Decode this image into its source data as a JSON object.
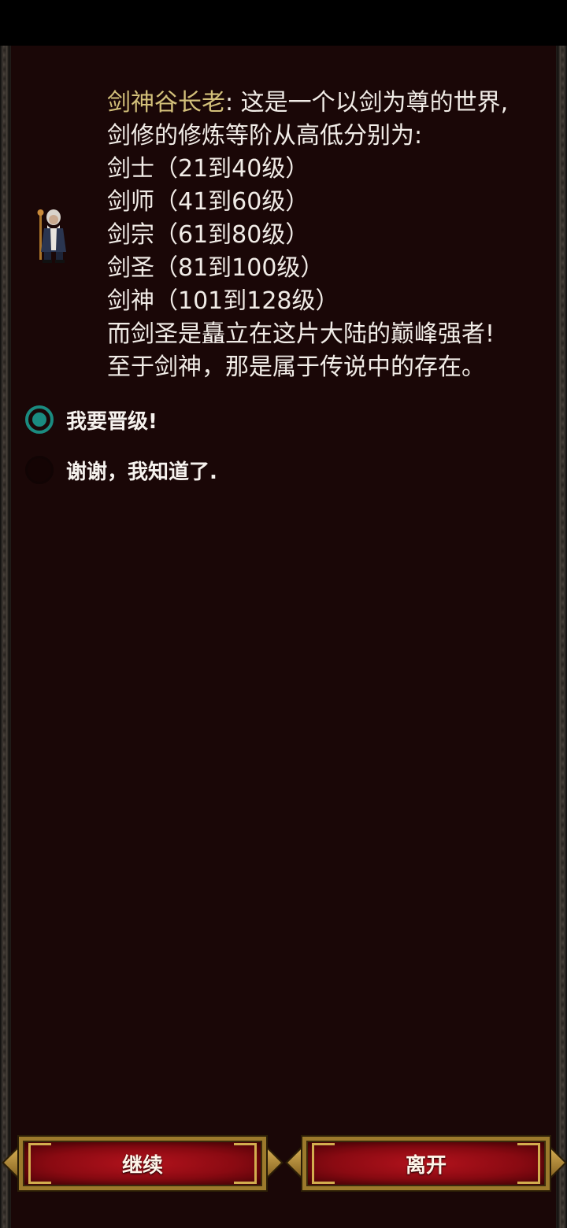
{
  "dialog": {
    "speaker": "剑神谷长老",
    "separator": ": ",
    "first_line": "这是一个以剑为尊的世界,",
    "lines": [
      "剑修的修炼等阶从高低分别为:",
      "剑士（21到40级）",
      "剑师（41到60级）",
      "剑宗（61到80级）",
      "剑圣（81到100级）",
      "剑神（101到128级）",
      "而剑圣是矗立在这片大陆的巅峰强者!",
      "至于剑神，那是属于传说中的存在。"
    ],
    "portrait": "old-elder-npc-icon"
  },
  "options": [
    {
      "label": "我要晋级!",
      "selected": true
    },
    {
      "label": "谢谢，我知道了.",
      "selected": false
    }
  ],
  "buttons": {
    "continue_label": "继续",
    "leave_label": "离开"
  },
  "colors": {
    "panel_bg": "#1a0707",
    "speaker_text": "#d3c07a",
    "body_text": "#f1ece7",
    "radio_selected": "#1a8b80",
    "button_red": "#b3121c",
    "button_gold": "#9c7a2c"
  }
}
